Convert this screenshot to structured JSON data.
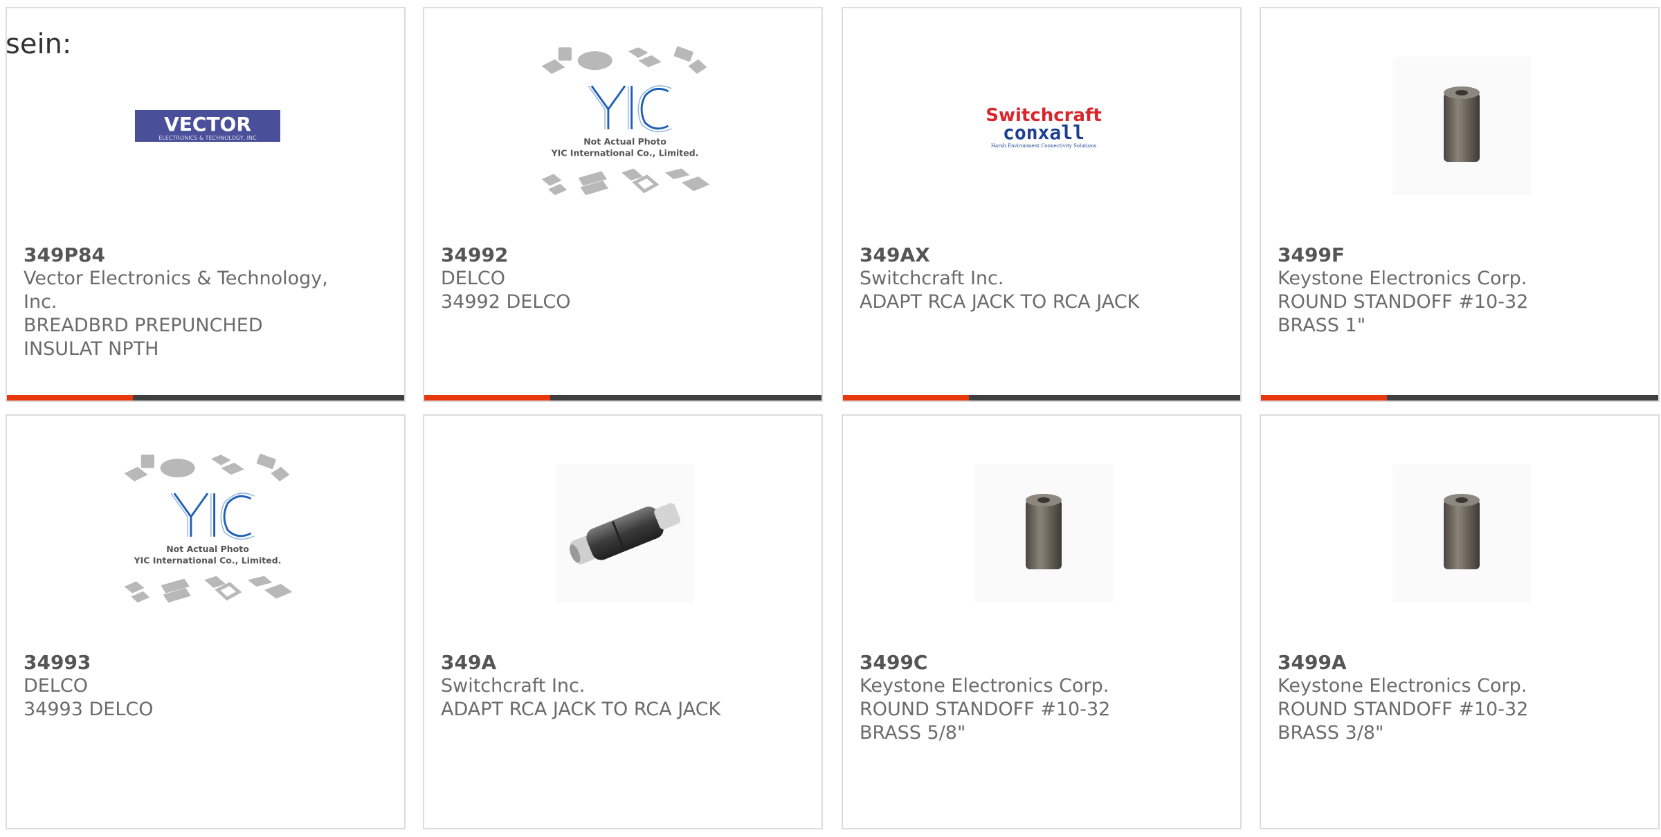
{
  "header": {
    "lead_text": "sein:"
  },
  "colors": {
    "accent": "#e8380d",
    "bar": "#3f3f3f",
    "border": "#dcdcdc",
    "text": "#6b6b6b"
  },
  "products": [
    {
      "part": "349P84",
      "mfr_line1": "Vector Electronics & Technology,",
      "mfr_line2": "Inc.",
      "desc_line1": "BREADBRD PREPUNCHED",
      "desc_line2": "INSULAT NPTH",
      "image": "vector-logo",
      "logo_text": "VECTOR",
      "logo_sub": "ELECTRONICS & TECHNOLOGY, INC"
    },
    {
      "part": "34992",
      "mfr_line1": "DELCO",
      "desc_line1": "34992 DELCO",
      "image": "yic-placeholder",
      "ph_line1": "Not Actual Photo",
      "ph_line2": "YIC International Co., Limited."
    },
    {
      "part": "349AX",
      "mfr_line1": "Switchcraft Inc.",
      "desc_line1": "ADAPT RCA JACK TO RCA JACK",
      "image": "switchcraft-logo",
      "logo_top": "Switchcraft",
      "logo_bottom": "conxall",
      "logo_tag": "Harsh Environment Connectivity Solutions"
    },
    {
      "part": "3499F",
      "mfr_line1": "Keystone Electronics Corp.",
      "desc_line1": "ROUND STANDOFF #10-32",
      "desc_line2": "BRASS 1\"",
      "image": "standoff-photo"
    },
    {
      "part": "34993",
      "mfr_line1": "DELCO",
      "desc_line1": "34993 DELCO",
      "image": "yic-placeholder",
      "ph_line1": "Not Actual Photo",
      "ph_line2": "YIC International Co., Limited."
    },
    {
      "part": "349A",
      "mfr_line1": "Switchcraft Inc.",
      "desc_line1": "ADAPT RCA JACK TO RCA JACK",
      "image": "rca-adapter-photo"
    },
    {
      "part": "3499C",
      "mfr_line1": "Keystone Electronics Corp.",
      "desc_line1": "ROUND STANDOFF #10-32",
      "desc_line2": "BRASS 5/8\"",
      "image": "standoff-photo"
    },
    {
      "part": "3499A",
      "mfr_line1": "Keystone Electronics Corp.",
      "desc_line1": "ROUND STANDOFF #10-32",
      "desc_line2": "BRASS 3/8\"",
      "image": "standoff-photo"
    }
  ]
}
